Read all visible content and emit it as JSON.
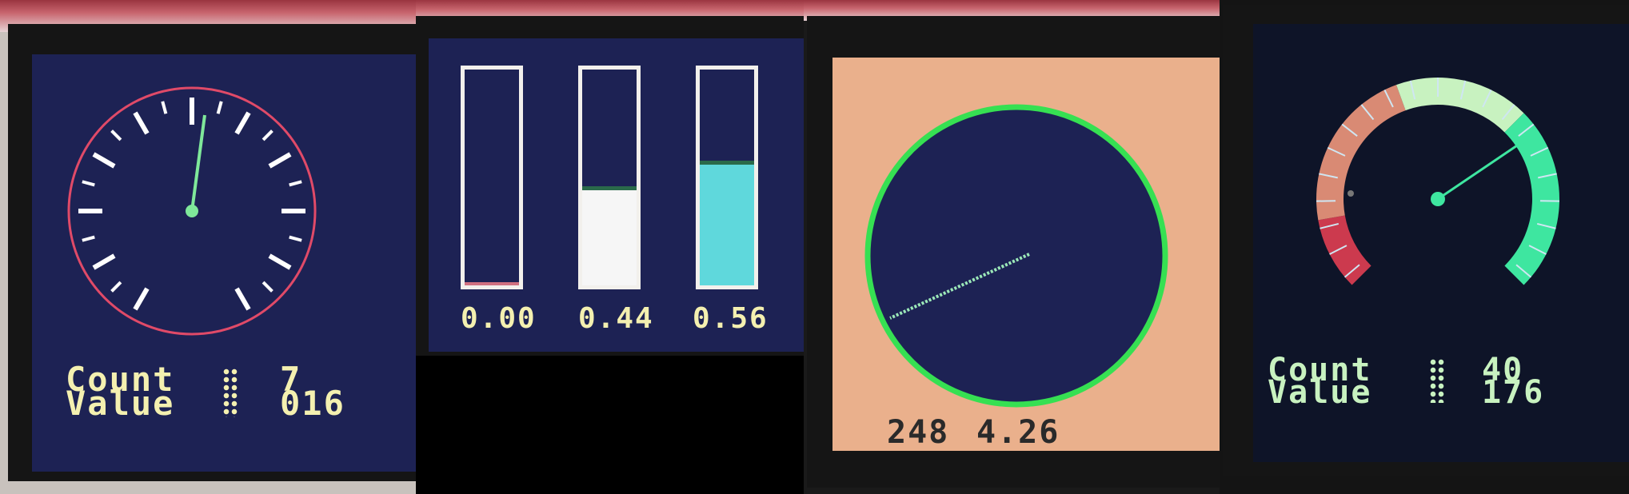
{
  "panel1": {
    "row1_label": "Count",
    "row1_value": "7",
    "row2_label": "Value",
    "row2_value": "016"
  },
  "panel2": {
    "bars": [
      {
        "value_text": "0.00",
        "level": 0.0,
        "fill_color": "#d07080"
      },
      {
        "value_text": "0.44",
        "level": 0.44,
        "fill_color": "#f6f6f6"
      },
      {
        "value_text": "0.56",
        "level": 0.56,
        "fill_color": "#5fd8dc"
      }
    ]
  },
  "panel3": {
    "readout_left": "248",
    "readout_right": "4.26"
  },
  "panel4": {
    "row1_label": "Count",
    "row1_value": "40",
    "row2_label": "Value",
    "row2_value": "176"
  },
  "colors": {
    "dark_navy": "#1d2254",
    "dial_red": "#e04a68",
    "needle_green": "#7fe89a",
    "peach": "#eab08c",
    "ring_green": "#36e052",
    "lcd_yellow": "#f4f0b0",
    "gauge_green_light": "#c8f2c0",
    "gauge_green": "#3ee6a0",
    "gauge_salmon": "#d98a74",
    "gauge_red": "#cc3a4e"
  }
}
